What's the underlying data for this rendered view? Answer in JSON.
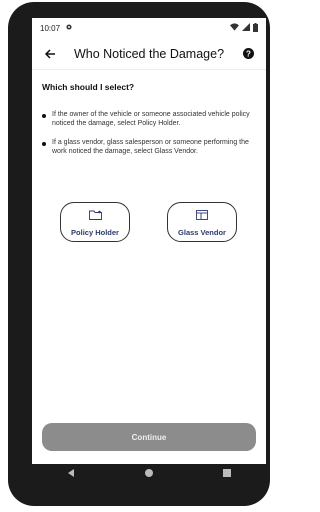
{
  "status": {
    "time": "10:07"
  },
  "appbar": {
    "title": "Who Noticed the Damage?"
  },
  "content": {
    "heading": "Which should I select?",
    "bullets": [
      "If the owner of the vehicle or someone associated vehicle policy noticed the damage, select Policy Holder.",
      "If a glass vendor, glass salesperson or someone performing the work noticed the damage, select Glass Vendor."
    ]
  },
  "choices": {
    "policy_holder": "Policy Holder",
    "glass_vendor": "Glass Vendor"
  },
  "footer": {
    "continue_label": "Continue"
  },
  "colors": {
    "accent": "#2c3a6e",
    "button_disabled": "#8c8c8c"
  },
  "icons": [
    "settings-icon",
    "wifi-icon",
    "signal-icon",
    "battery-icon",
    "back-arrow-icon",
    "help-icon",
    "folder-icon",
    "window-icon",
    "nav-back-icon",
    "nav-home-icon",
    "nav-recents-icon"
  ]
}
